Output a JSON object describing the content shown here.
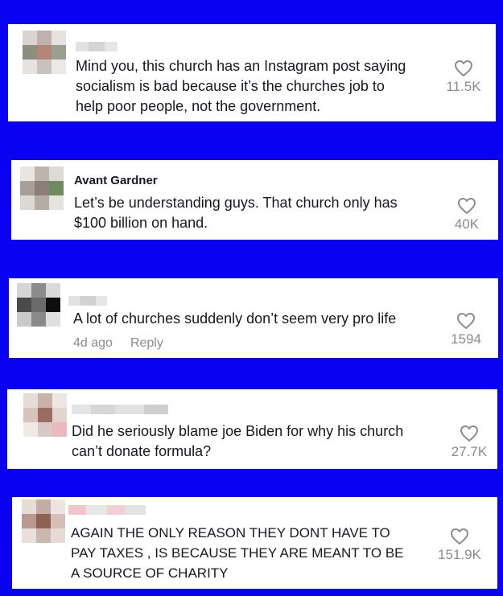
{
  "comments": [
    {
      "username": "",
      "text": "Mind you, this church has an Instagram post saying\nsocialism is bad because it’s the churches job to\nhelp poor people, not the government.",
      "likes": "11.5K",
      "age": "",
      "reply_label": ""
    },
    {
      "username": "Avant Gardner",
      "text": "Let’s be understanding guys. That church only has\n$100 billion on hand.",
      "likes": "40K",
      "age": "",
      "reply_label": ""
    },
    {
      "username": "",
      "text": "A lot of churches suddenly don’t seem very pro life",
      "likes": "1594",
      "age": "4d ago",
      "reply_label": "Reply"
    },
    {
      "username": "",
      "text": "Did he seriously blame joe Biden for why his church\ncan’t donate formula?",
      "likes": "27.7K",
      "age": "",
      "reply_label": ""
    },
    {
      "username": "",
      "text": "AGAIN THE ONLY REASON THEY DONT HAVE TO\nPAY TAXES , IS BECAUSE THEY ARE MEANT TO BE\nA SOURCE OF CHARITY",
      "likes": "151.9K",
      "age": "",
      "reply_label": ""
    }
  ],
  "icons": {
    "like": "heart-outline-icon",
    "avatar": "pixelated-avatar"
  },
  "colors": {
    "background": "#0a00f2",
    "card": "#ffffff",
    "text": "#161823",
    "muted": "#8a8b91"
  }
}
